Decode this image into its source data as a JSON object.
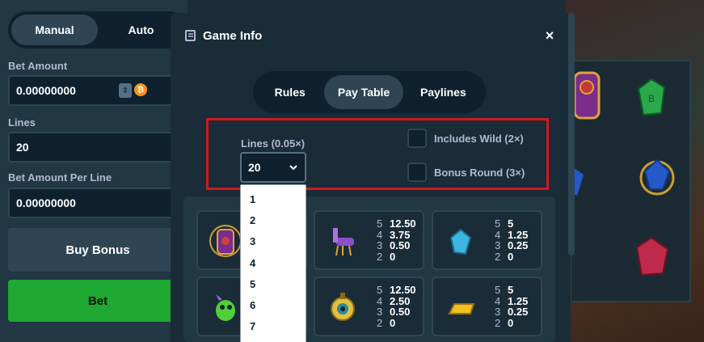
{
  "bet_panel": {
    "mode_manual": "Manual",
    "mode_auto": "Auto",
    "bet_amount_label": "Bet Amount",
    "bet_amount_value": "0.00000000",
    "lines_label": "Lines",
    "lines_value": "20",
    "bet_per_line_label": "Bet Amount Per Line",
    "bet_per_line_value": "0.00000000",
    "buy_bonus": "Buy Bonus",
    "bet": "Bet",
    "currency_icon": "bitcoin-icon",
    "currency_symbol": "₿"
  },
  "modal": {
    "title": "Game Info",
    "title_icon": "document-icon",
    "close_label": "×",
    "tabs": [
      {
        "label": "Rules",
        "active": false
      },
      {
        "label": "Pay Table",
        "active": true
      },
      {
        "label": "Paylines",
        "active": false
      }
    ],
    "lines_select_label": "Lines (0.05×)",
    "lines_select_value": "20",
    "includes_wild_label": "Includes Wild (2×)",
    "bonus_round_label": "Bonus Round (3×)",
    "dropdown_options": [
      "1",
      "2",
      "3",
      "4",
      "5",
      "6",
      "7"
    ],
    "highlight_color": "#d3171d"
  },
  "pay_table": [
    {
      "symbol": "llama-icon",
      "payouts": [
        {
          "count": "5",
          "amount": "12.50"
        },
        {
          "count": "4",
          "amount": "3.75"
        },
        {
          "count": "3",
          "amount": "0.50"
        },
        {
          "count": "2",
          "amount": "0"
        }
      ]
    },
    {
      "symbol": "blue-gem-icon",
      "payouts": [
        {
          "count": "5",
          "amount": "5"
        },
        {
          "count": "4",
          "amount": "1.25"
        },
        {
          "count": "3",
          "amount": "0.25"
        },
        {
          "count": "2",
          "amount": "0"
        }
      ]
    },
    {
      "symbol": "eye-idol-icon",
      "payouts": [
        {
          "count": "5",
          "amount": "12.50"
        },
        {
          "count": "4",
          "amount": "2.50"
        },
        {
          "count": "3",
          "amount": "0.50"
        },
        {
          "count": "2",
          "amount": "0"
        }
      ]
    },
    {
      "symbol": "gold-bar-icon",
      "payouts": [
        {
          "count": "5",
          "amount": "5"
        },
        {
          "count": "4",
          "amount": "1.25"
        },
        {
          "count": "3",
          "amount": "0.25"
        },
        {
          "count": "2",
          "amount": "0"
        }
      ]
    }
  ],
  "colors": {
    "bet_button": "#1fa832",
    "panel": "#213743",
    "modal": "#1a2c38"
  }
}
